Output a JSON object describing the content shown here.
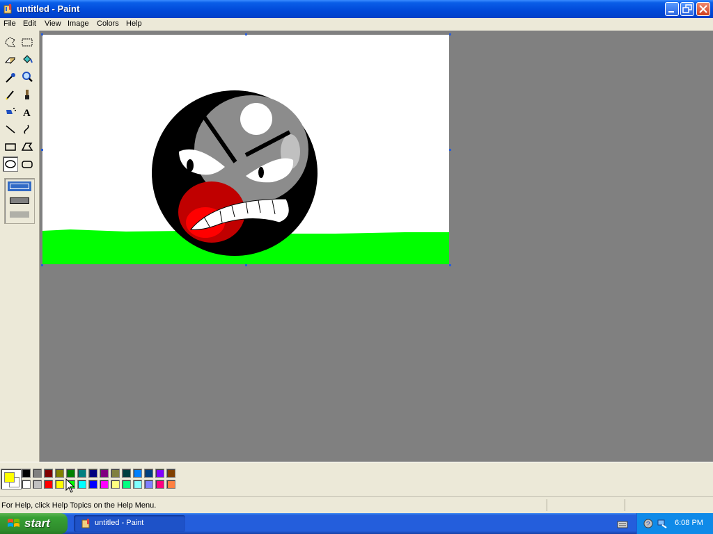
{
  "window": {
    "title": "untitled - Paint"
  },
  "menu": [
    "File",
    "Edit",
    "View",
    "Image",
    "Colors",
    "Help"
  ],
  "tools": [
    {
      "name": "free-form-select-tool-icon"
    },
    {
      "name": "select-tool-icon"
    },
    {
      "name": "eraser-tool-icon"
    },
    {
      "name": "fill-with-color-tool-icon"
    },
    {
      "name": "pick-color-tool-icon"
    },
    {
      "name": "magnifier-tool-icon"
    },
    {
      "name": "pencil-tool-icon"
    },
    {
      "name": "brush-tool-icon"
    },
    {
      "name": "airbrush-tool-icon"
    },
    {
      "name": "text-tool-icon"
    },
    {
      "name": "line-tool-icon"
    },
    {
      "name": "curve-tool-icon"
    },
    {
      "name": "rectangle-tool-icon"
    },
    {
      "name": "polygon-tool-icon"
    },
    {
      "name": "ellipse-tool-icon"
    },
    {
      "name": "rounded-rectangle-tool-icon"
    }
  ],
  "selected_tool": "ellipse-tool-icon",
  "colors": {
    "foreground": "#ffff00",
    "background": "#ffffff",
    "row1": [
      "#000000",
      "#808080",
      "#800000",
      "#808000",
      "#008000",
      "#008080",
      "#000080",
      "#800080",
      "#808040",
      "#004040",
      "#0080ff",
      "#004080",
      "#8000ff",
      "#804000"
    ],
    "row2": [
      "#ffffff",
      "#c0c0c0",
      "#ff0000",
      "#ffff00",
      "#00ff00",
      "#00ffff",
      "#0000ff",
      "#ff00ff",
      "#ffff80",
      "#00ff80",
      "#80ffff",
      "#8080ff",
      "#ff0080",
      "#ff8040"
    ]
  },
  "status": {
    "help_text": "For Help, click Help Topics on the Help Menu."
  },
  "taskbar": {
    "start_label": "start",
    "task_label": "untitled - Paint",
    "clock": "6:08 PM"
  }
}
